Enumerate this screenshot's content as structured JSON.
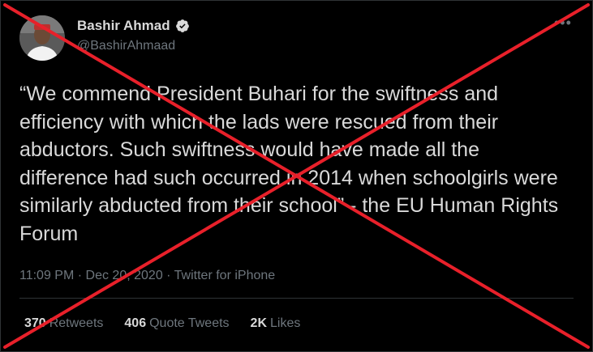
{
  "author": {
    "name": "Bashir Ahmad",
    "handle": "@BashirAhmaad",
    "verified_icon": "verified-badge-icon"
  },
  "more_icon": "more-options-icon",
  "tweet": {
    "text": "“We commend President Buhari for the swiftness and efficiency with which the lads were rescued from their abductors. Such swiftness would have made all the difference had such occurred in 2014 when schoolgirls were similarly abducted from their school” - the EU Human Rights Forum",
    "time": "11:09 PM",
    "date": "Dec 20, 2020",
    "source": "Twitter for iPhone",
    "separator": "·"
  },
  "stats": {
    "retweets_count": "370",
    "retweets_label": "Retweets",
    "quotes_count": "406",
    "quotes_label": "Quote Tweets",
    "likes_count": "2K",
    "likes_label": "Likes"
  },
  "overlay": {
    "type": "red-x-cross",
    "color": "#e8202a"
  },
  "colors": {
    "background": "#000000",
    "text": "#d9d9d9",
    "secondary": "#6e767d",
    "verified": "#d9d9d9"
  }
}
